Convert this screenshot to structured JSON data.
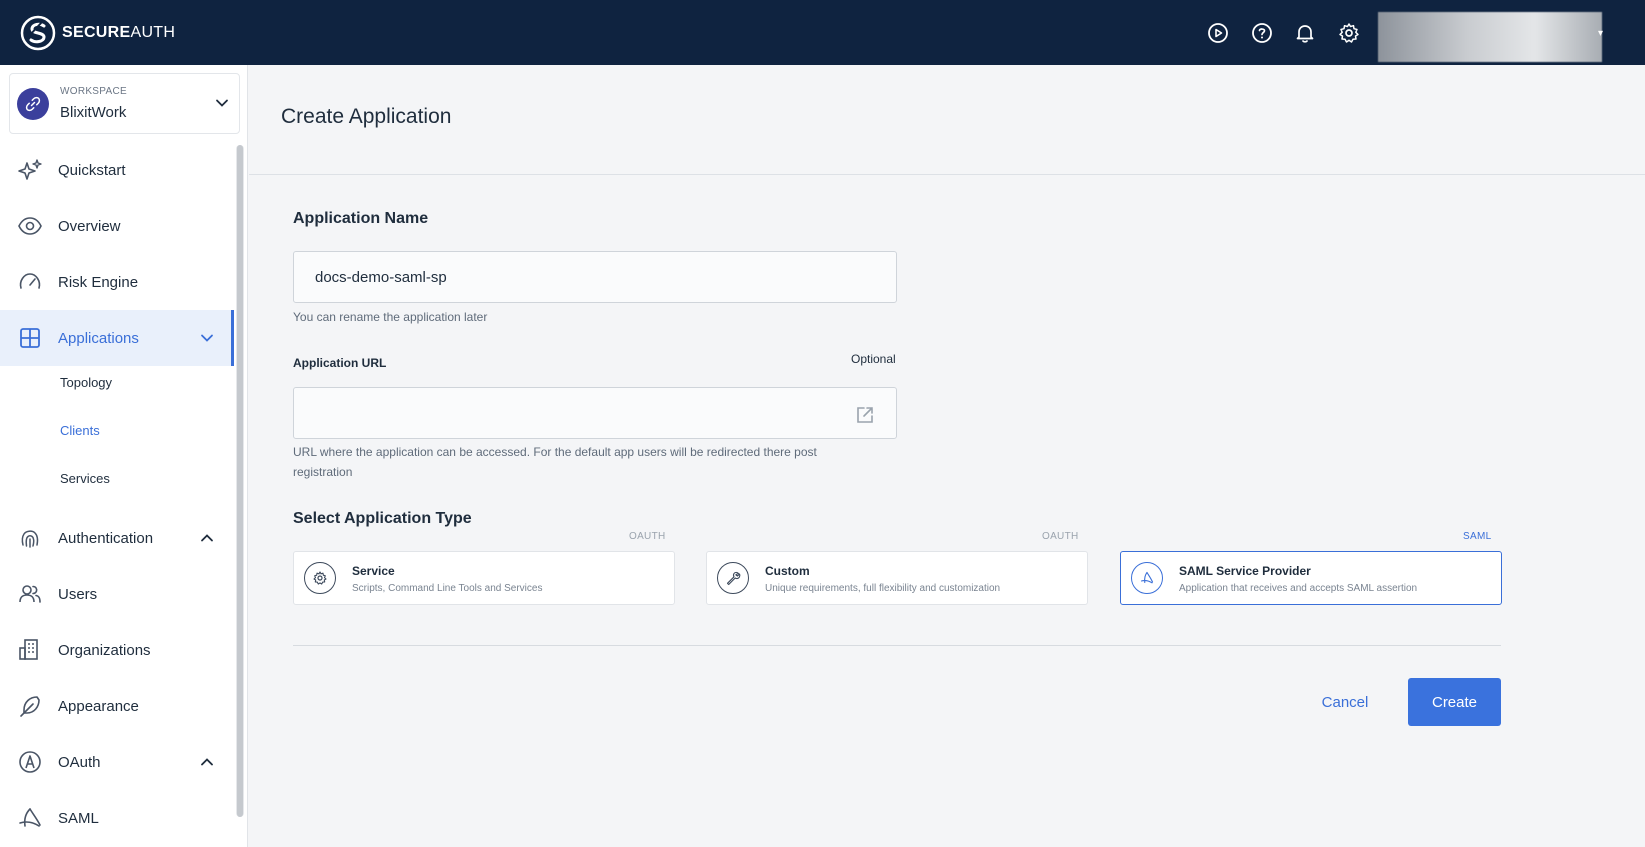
{
  "brand": {
    "name_bold": "SECURE",
    "name_rest": "AUTH"
  },
  "header_icons": [
    "play-circle-icon",
    "help-icon",
    "bell-icon",
    "gear-icon"
  ],
  "workspace": {
    "label": "WORKSPACE",
    "name": "BlixitWork"
  },
  "nav": {
    "quickstart": "Quickstart",
    "overview": "Overview",
    "risk_engine": "Risk Engine",
    "applications": "Applications",
    "topology": "Topology",
    "clients": "Clients",
    "services": "Services",
    "authentication": "Authentication",
    "users": "Users",
    "organizations": "Organizations",
    "appearance": "Appearance",
    "oauth": "OAuth",
    "saml": "SAML"
  },
  "page": {
    "title": "Create Application"
  },
  "form": {
    "app_name_title": "Application Name",
    "app_name_value": "docs-demo-saml-sp",
    "app_name_helper": "You can rename the application later",
    "app_url_label": "Application URL",
    "app_url_optional": "Optional",
    "app_url_value": "",
    "app_url_helper_1": "URL where the application can be accessed. For the default app users will be redirected there post",
    "app_url_helper_2": "registration",
    "type_title": "Select Application Type",
    "types": [
      {
        "badge": "OAUTH",
        "title": "Service",
        "desc": "Scripts, Command Line Tools and Services",
        "icon": "gear-icon"
      },
      {
        "badge": "OAUTH",
        "title": "Custom",
        "desc": "Unique requirements, full flexibility and customization",
        "icon": "wrench-icon"
      },
      {
        "badge": "SAML",
        "title": "SAML Service Provider",
        "desc": "Application that receives and accepts SAML assertion",
        "icon": "saml-icon",
        "selected": true
      }
    ],
    "cancel_label": "Cancel",
    "create_label": "Create"
  },
  "colors": {
    "accent": "#3a72dd",
    "topbar": "#0f2340",
    "active_bg": "#e9f0fb"
  }
}
